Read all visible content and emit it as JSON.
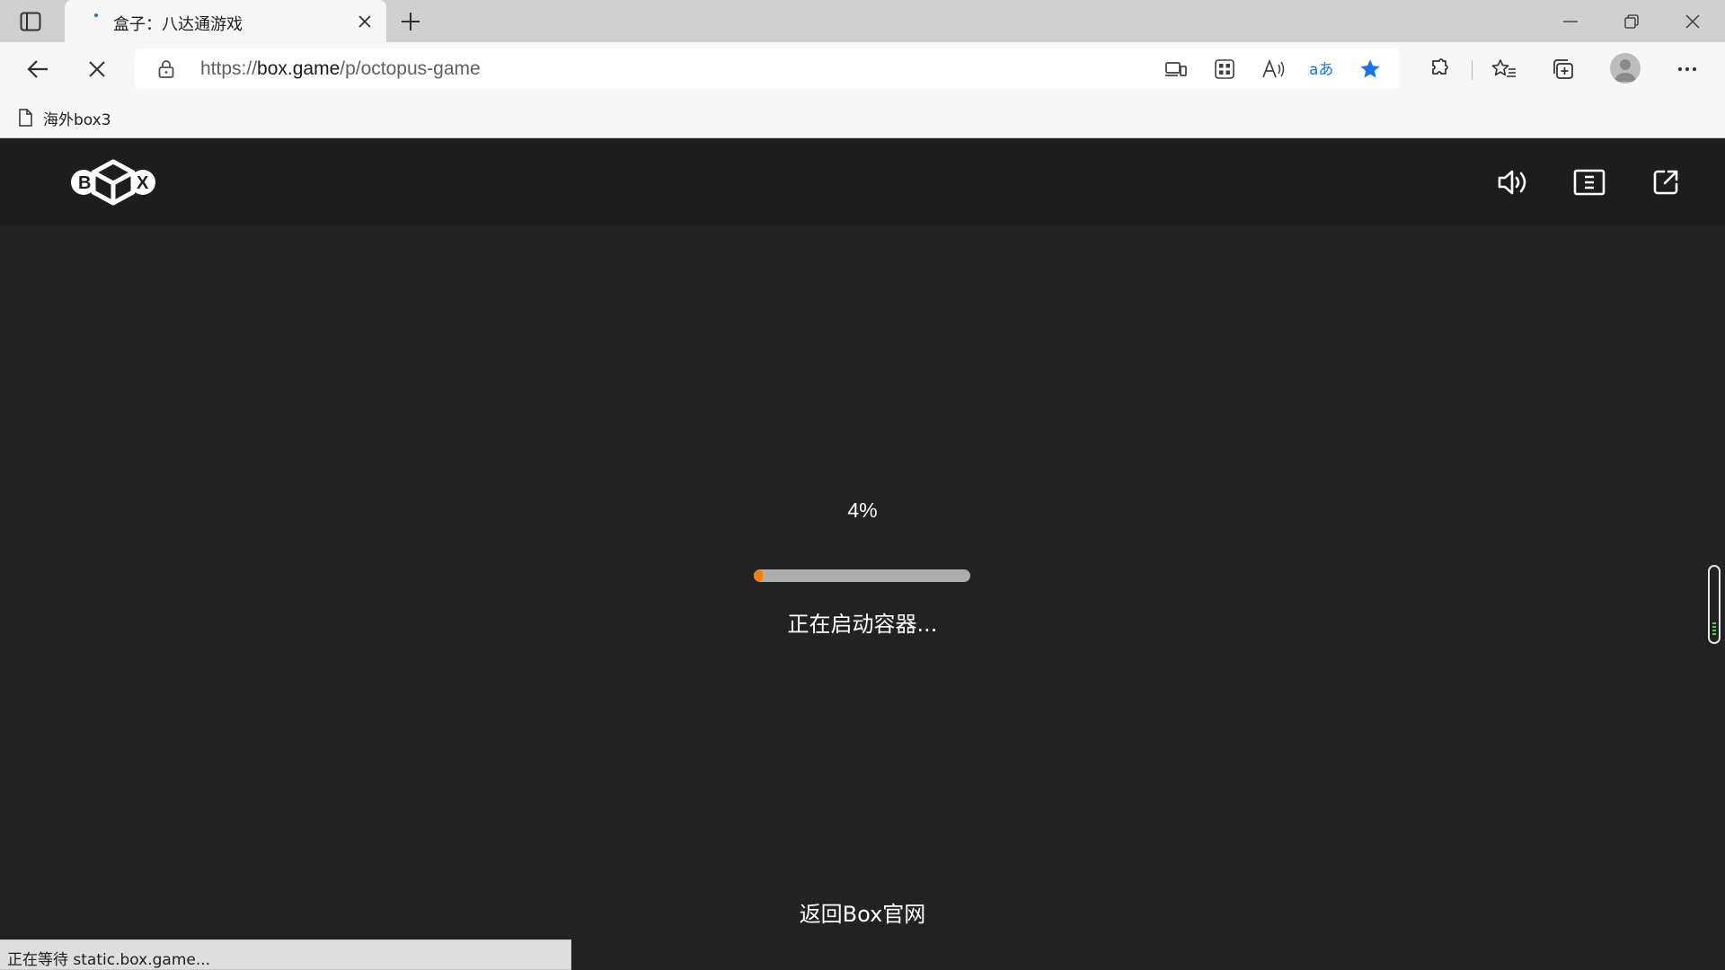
{
  "browser": {
    "tab": {
      "title": "盒子：八达通游戏"
    },
    "address_bar": {
      "url_prefix": "https://",
      "url_domain": "box.game",
      "url_path": "/p/octopus-game"
    },
    "bookmarks": [
      {
        "label": "海外box3"
      }
    ],
    "status_bar": {
      "text": "正在等待 static.box.game..."
    },
    "accent_color": "#1a73e8"
  },
  "page": {
    "logo": {
      "text": "BOX",
      "icon": "box-logo-icon"
    },
    "header_icons": [
      "speaker-icon",
      "menu-icon",
      "open-external-icon"
    ],
    "loading": {
      "percent_label": "4%",
      "progress": 0.04,
      "progress_color": "#f07f10",
      "message": "正在启动容器..."
    },
    "back_link": "返回Box官网",
    "background_color": "#222222"
  }
}
